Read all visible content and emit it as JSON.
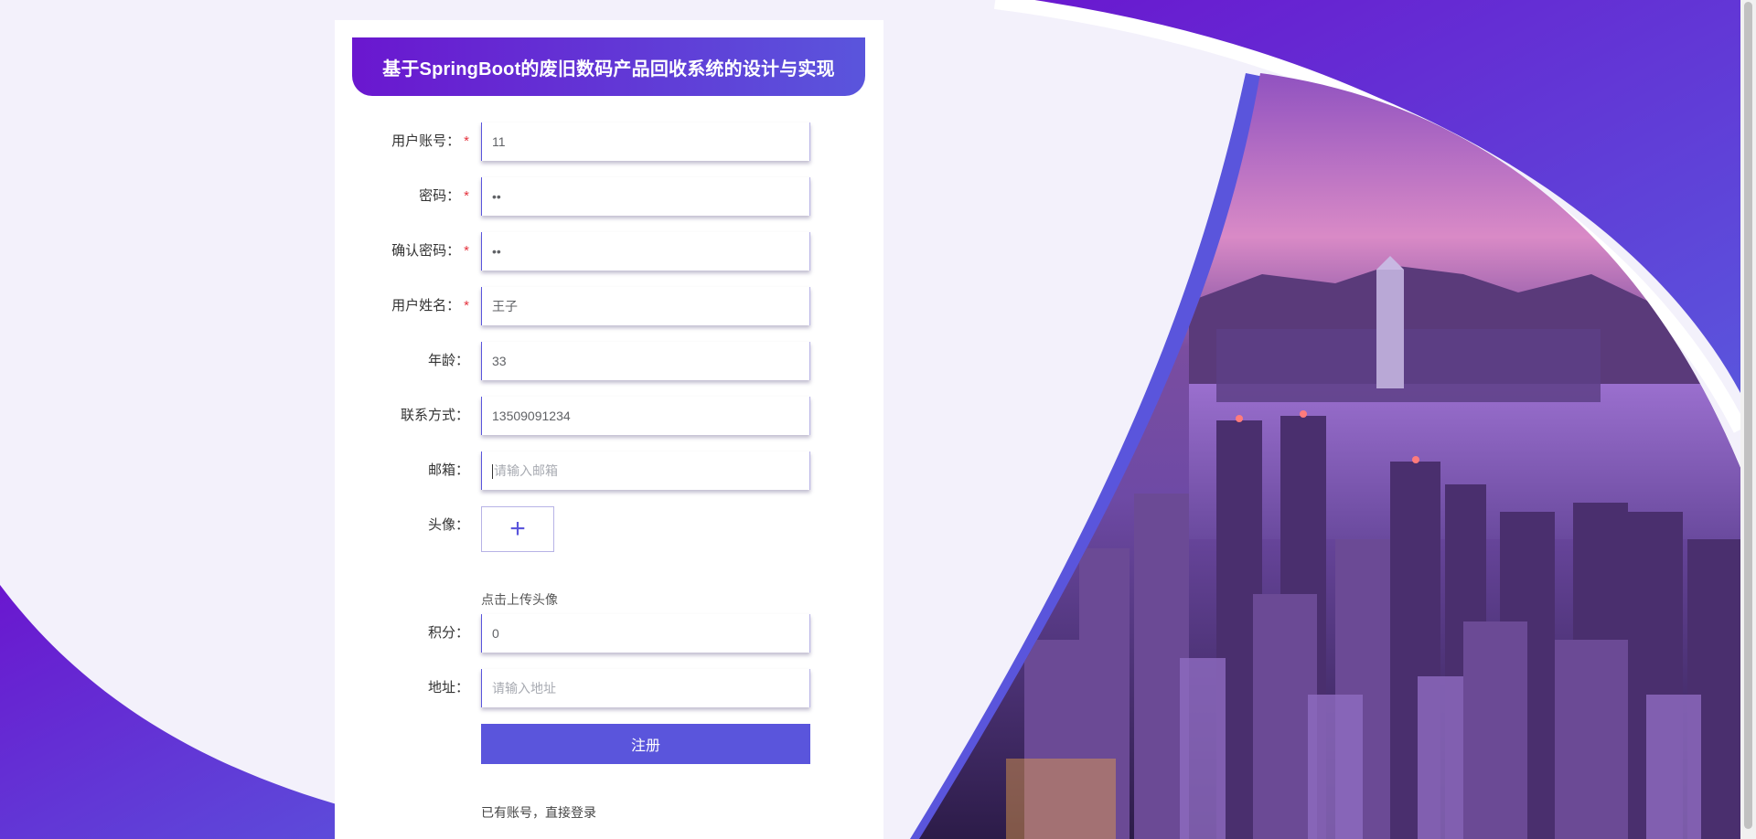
{
  "page": {
    "title": "基于SpringBoot的废旧数码产品回收系统的设计与实现",
    "theme": {
      "accent": "#5a55dc",
      "accent_dark": "#6a17cf",
      "background": "#f3f1fb",
      "required": "#e5343f"
    }
  },
  "form": {
    "fields": [
      {
        "key": "username",
        "label": "用户账号：",
        "required": true,
        "value": "11",
        "placeholder": ""
      },
      {
        "key": "password",
        "label": "密码：",
        "required": true,
        "value": "••",
        "placeholder": ""
      },
      {
        "key": "confirm_password",
        "label": "确认密码：",
        "required": true,
        "value": "••",
        "placeholder": ""
      },
      {
        "key": "name",
        "label": "用户姓名：",
        "required": true,
        "value": "王子",
        "placeholder": ""
      },
      {
        "key": "age",
        "label": "年龄：",
        "required": false,
        "value": "33",
        "placeholder": ""
      },
      {
        "key": "phone",
        "label": "联系方式：",
        "required": false,
        "value": "13509091234",
        "placeholder": ""
      },
      {
        "key": "email",
        "label": "邮箱：",
        "required": false,
        "value": "",
        "placeholder": "请输入邮箱"
      },
      {
        "key": "points",
        "label": "积分：",
        "required": false,
        "value": "0",
        "placeholder": ""
      },
      {
        "key": "address",
        "label": "地址：",
        "required": false,
        "value": "",
        "placeholder": "请输入地址"
      }
    ],
    "avatar": {
      "label": "头像：",
      "upload_icon": "plus-icon",
      "hint": "点击上传头像"
    },
    "required_mark": "*",
    "register_label": "注册",
    "login_link": "已有账号，直接登录"
  },
  "icons": {
    "upload": "plus-icon",
    "scroll": "scrollbar"
  }
}
